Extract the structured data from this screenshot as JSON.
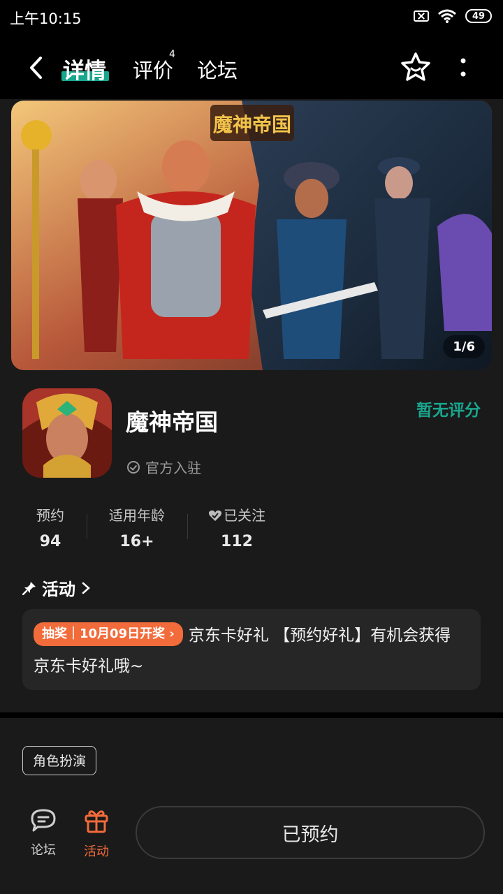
{
  "status_bar": {
    "time": "上午10:15",
    "battery": "49"
  },
  "nav": {
    "tabs": [
      {
        "label": "详情",
        "active": true
      },
      {
        "label": "评价",
        "badge": "4"
      },
      {
        "label": "论坛"
      }
    ]
  },
  "banner": {
    "pager": "1/6",
    "banner_logo_text": "魔神帝国"
  },
  "app": {
    "name": "魔神帝国",
    "rating": "暂无评分",
    "official": "官方入驻"
  },
  "stats": [
    {
      "label": "预约",
      "value": "94"
    },
    {
      "label": "适用年龄",
      "value": "16+"
    },
    {
      "label": "已关注",
      "value": "112"
    }
  ],
  "activity": {
    "heading": "活动",
    "tag_text": "抽奖｜10月09日开奖",
    "text": "京东卡好礼 【预约好礼】有机会获得京东卡好礼哦~"
  },
  "tags": [
    "角色扮演"
  ],
  "bottom_bar": {
    "forum_label": "论坛",
    "activity_label": "活动",
    "reserve_button": "已预约"
  },
  "colors": {
    "accent": "#19a68e",
    "orange": "#f26b3a",
    "background": "#1a1a1a"
  }
}
